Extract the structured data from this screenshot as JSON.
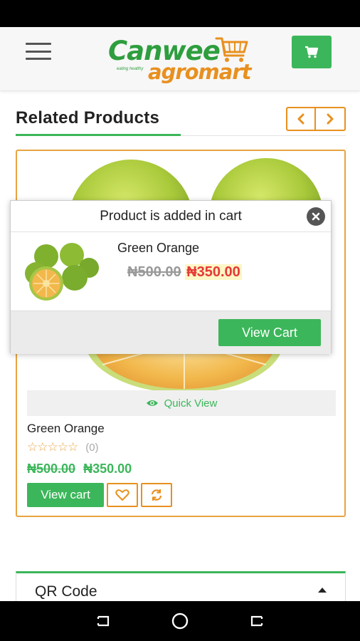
{
  "app": {
    "logo_line1": "Canwee",
    "logo_line2": "agromart",
    "logo_tagline": "eating healthy",
    "brand_green": "#3cb65a",
    "brand_orange": "#e8901f"
  },
  "header": {
    "menu_icon": "hamburger-icon",
    "cart_icon": "shopping-cart-icon"
  },
  "section": {
    "title": "Related Products",
    "prev_icon": "chevron-left-icon",
    "next_icon": "chevron-right-icon"
  },
  "product": {
    "name": "Green Orange",
    "rating_stars": "☆☆☆☆☆",
    "rating_value": 0,
    "review_count": "(0)",
    "old_price": "₦500.00",
    "new_price": "₦350.00",
    "quick_view_label": "Quick View",
    "view_cart_label": "View cart",
    "wishlist_icon": "heart-icon",
    "compare_icon": "refresh-icon"
  },
  "popup": {
    "title": "Product is added in cart",
    "product_name": "Green Orange",
    "old_price": "₦500.00",
    "new_price": "₦350.00",
    "view_cart_label": "View Cart",
    "close_icon": "close-icon"
  },
  "qr": {
    "title": "QR Code",
    "toggle_icon": "caret-up-icon"
  },
  "system_nav": {
    "recents_icon": "recents-icon",
    "home_icon": "home-icon",
    "back_icon": "back-icon"
  }
}
